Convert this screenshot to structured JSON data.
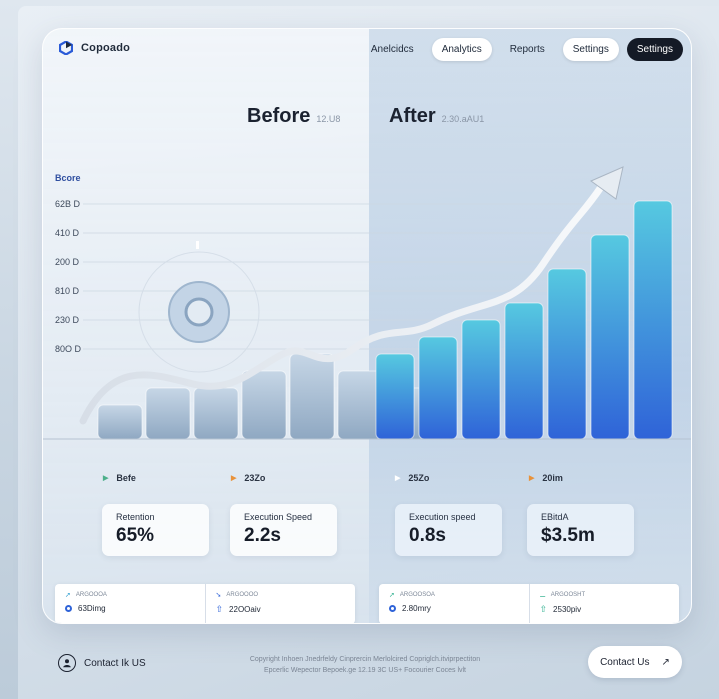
{
  "brand": {
    "name": "Copoado"
  },
  "nav": {
    "links": [
      {
        "label": "Anelcidcs",
        "style": "plain"
      },
      {
        "label": "Analytics",
        "style": "pill"
      },
      {
        "label": "Reports",
        "style": "plain"
      },
      {
        "label": "Settings",
        "style": "pill"
      },
      {
        "label": "Settings",
        "style": "dark"
      }
    ]
  },
  "headings": {
    "before": {
      "title": "Before",
      "sub": "12.U8"
    },
    "after": {
      "title": "After",
      "sub": "2.30.aAU1"
    }
  },
  "chart_data": {
    "type": "bar",
    "y_title": "Bcore",
    "y_ticks": [
      "62B D",
      "410 D",
      "200 D",
      "810 D",
      "230 D",
      "80O D"
    ],
    "before_values": [
      2,
      3,
      3,
      4,
      5,
      4,
      3
    ],
    "after_values": [
      5,
      6,
      7,
      8,
      10,
      12,
      14
    ],
    "trend": "rising"
  },
  "segments": [
    {
      "label": "Befe",
      "color": "#4caf8a"
    },
    {
      "label": "23Zo",
      "color": "#e8923a"
    },
    {
      "label": "25Zo",
      "color": "#ffffff"
    },
    {
      "label": "20im",
      "color": "#e8923a"
    }
  ],
  "kpis": [
    {
      "label": "Retention",
      "value": "65%"
    },
    {
      "label": "Execution Speed",
      "value": "2.2s"
    },
    {
      "label": "Execution speed",
      "value": "0.8s"
    },
    {
      "label": "EBitdA",
      "value": "$3.5m"
    }
  ],
  "stats": [
    {
      "caption": "ARGOOOA",
      "value": "63Dimg"
    },
    {
      "caption": "ARGOOOO",
      "value": "22OOaiv"
    },
    {
      "caption": "ARGOOSOA",
      "value": "2.80mry"
    },
    {
      "caption": "ARGOOSHT",
      "value": "2530piv"
    }
  ],
  "footer": {
    "contact_label": "Contact Ik US",
    "copyright_line1": "Copyright Inhoen Jnedrfeldy Cinprercin Merlolcired Copriglch.itviprpectiton",
    "copyright_line2": "Epcerlic Wepector Bepoek.ge 12.19 3C US+ Focourier Coces lvlt",
    "contact_button": "Contact Us",
    "contact_arrow": "↗"
  }
}
